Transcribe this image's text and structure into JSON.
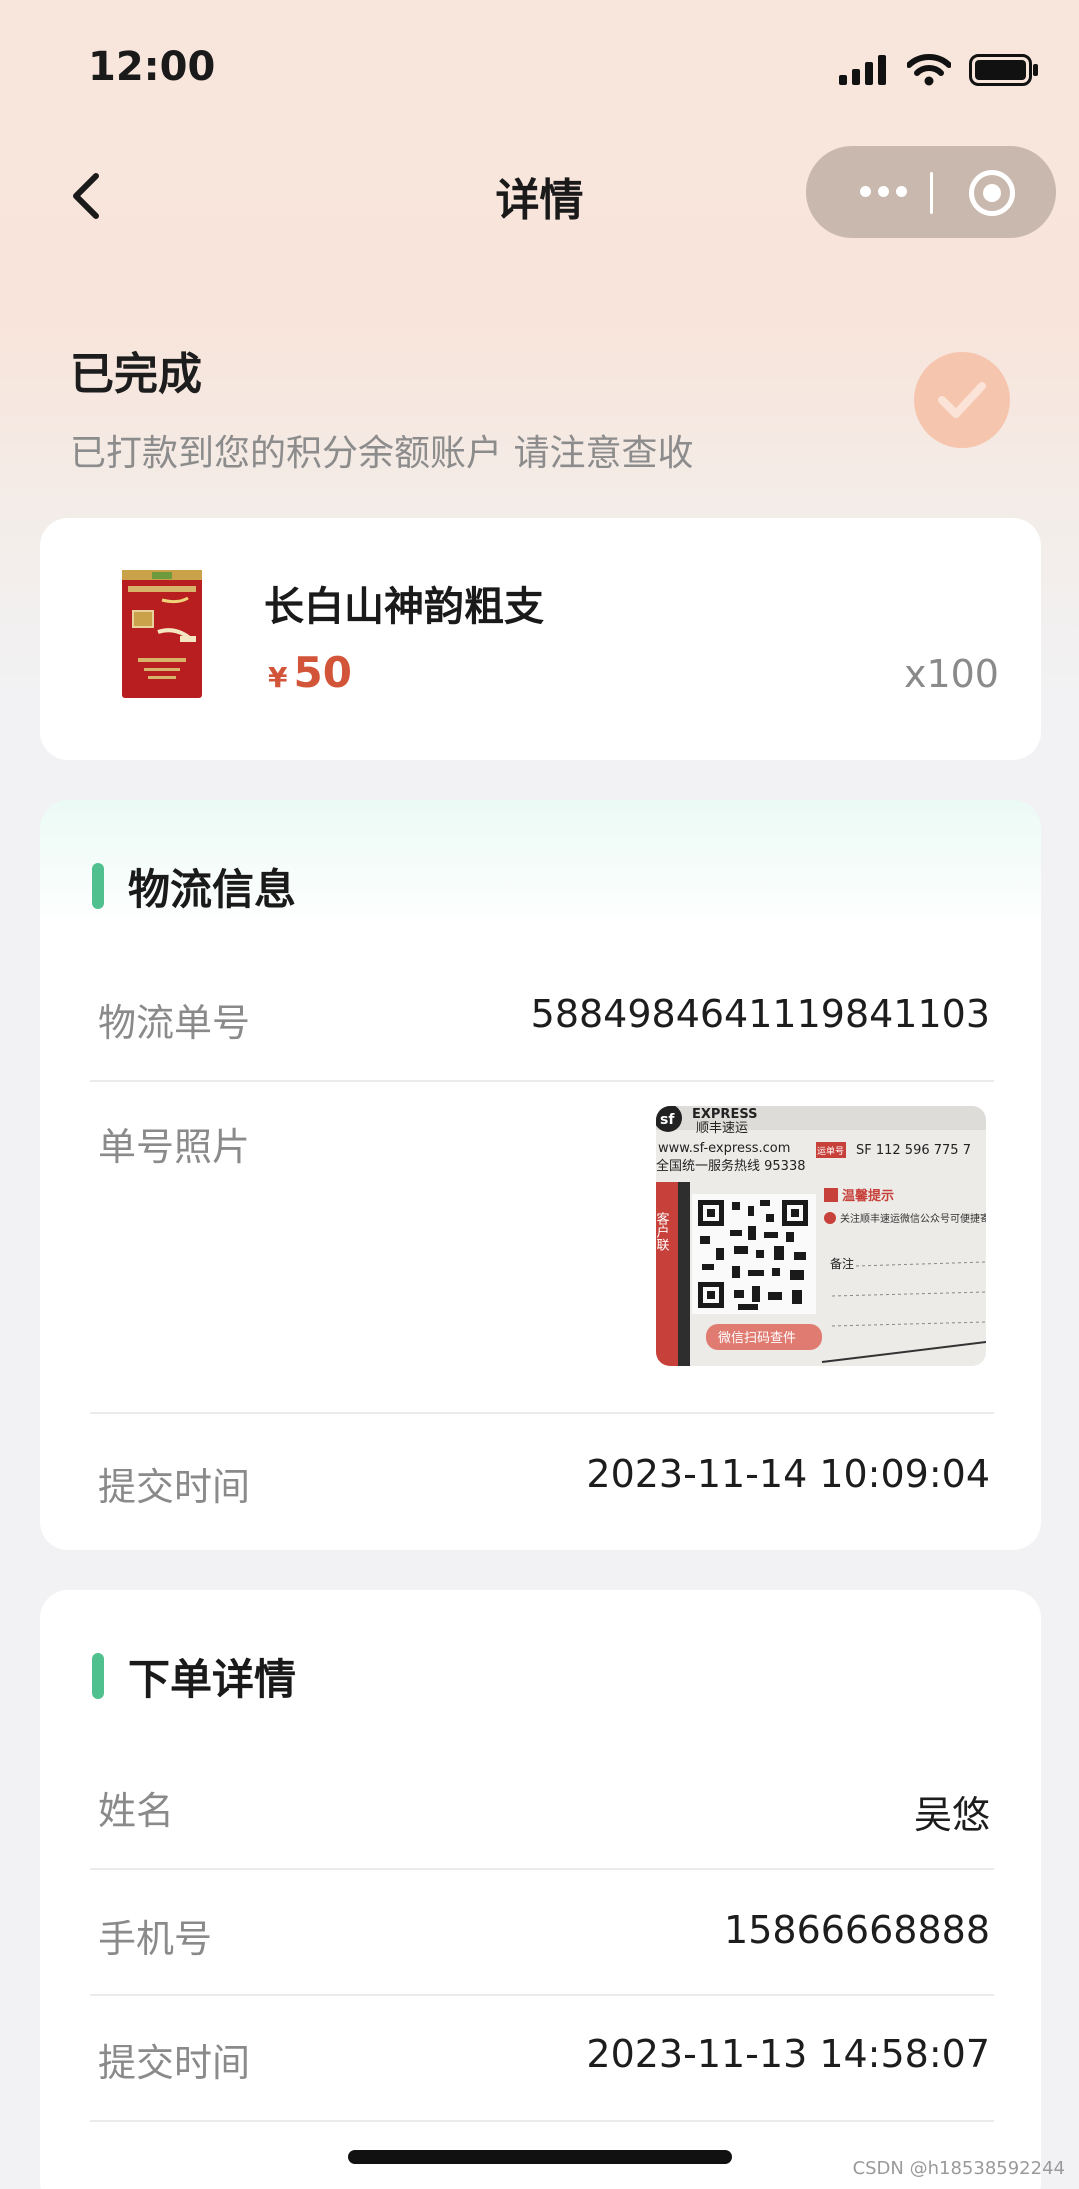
{
  "status_bar": {
    "time": "12:00"
  },
  "nav": {
    "title": "详情"
  },
  "order_status": {
    "title": "已完成",
    "subtitle": "已打款到您的积分余额账户 请注意查收"
  },
  "product": {
    "name": "长白山神韵粗支",
    "currency": "¥",
    "price": "50",
    "quantity": "x100"
  },
  "logistics": {
    "title": "物流信息",
    "rows": [
      {
        "label": "物流单号",
        "value": "5884984641119841103"
      },
      {
        "label": "单号照片"
      },
      {
        "label": "提交时间",
        "value": "2023-11-14 10:09:04"
      }
    ],
    "photo_text": {
      "brand": "EXPRESS",
      "brand_cn": "顺丰速运",
      "site": "www.sf-express.com",
      "hotline": "全国统一服务热线 95338",
      "waybill_label": "运单号",
      "waybill": "SF 112 596 775 7",
      "side_label": "客户联",
      "tip_title": "温馨提示",
      "tip_text": "关注顺丰速运微信公众号可便捷寄快递、查快递。",
      "remark": "备注",
      "scan": "微信扫码查件"
    }
  },
  "order": {
    "title": "下单详情",
    "rows": [
      {
        "label": "姓名",
        "value": "吴悠"
      },
      {
        "label": "手机号",
        "value": "15866668888"
      },
      {
        "label": "提交时间",
        "value": "2023-11-13 14:58:07"
      }
    ]
  },
  "watermark": "CSDN @h18538592244",
  "colors": {
    "accent_green": "#50c08e",
    "price_red": "#d2553a",
    "check_peach": "#f6c5ae",
    "header_bg": "#f8e6dd"
  }
}
